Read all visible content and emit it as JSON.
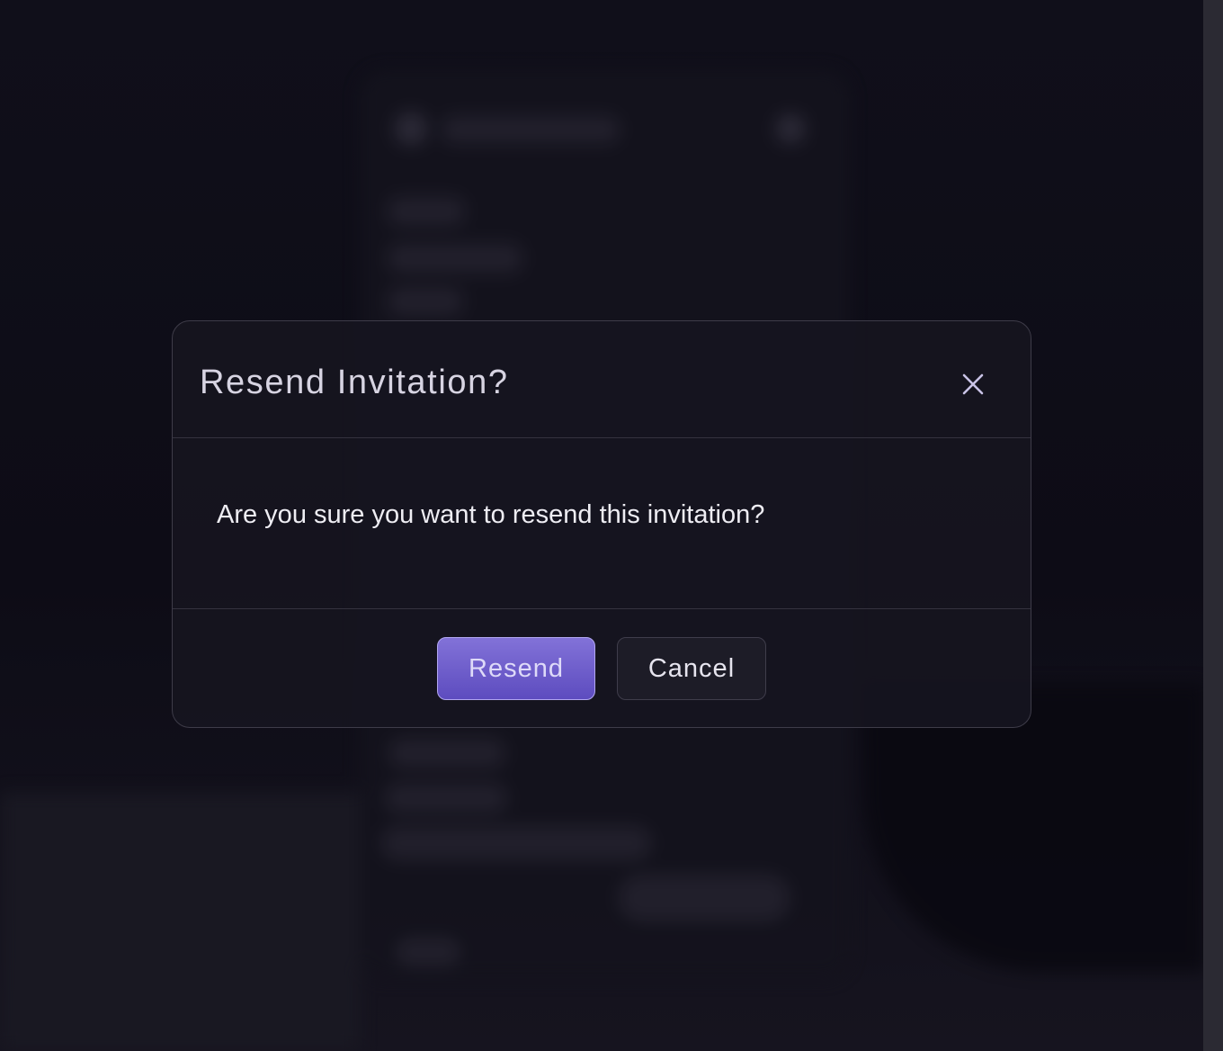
{
  "dialog": {
    "title": "Resend Invitation?",
    "message": "Are you sure you want to resend this invitation?",
    "confirm_label": "Resend",
    "cancel_label": "Cancel",
    "close_icon": "close-icon"
  },
  "colors": {
    "primary_button": "#6f5fd0",
    "primary_border": "#b1a6f0",
    "backdrop": "#0f0e18"
  }
}
